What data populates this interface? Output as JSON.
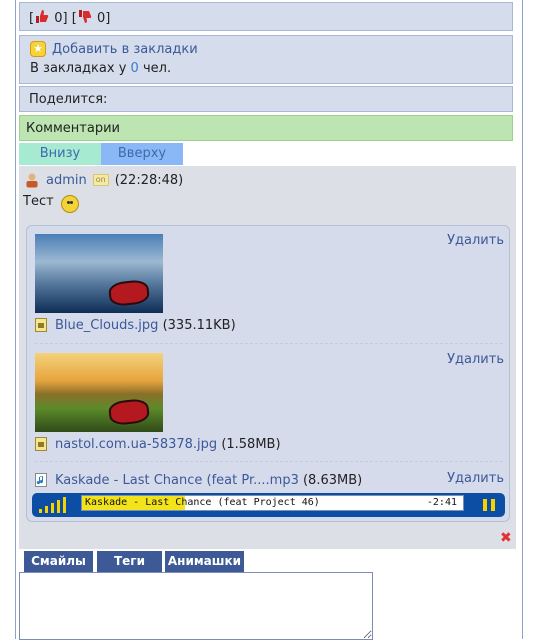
{
  "votes": {
    "open_bracket1": "[",
    "likes": "0",
    "close_bracket1": "]",
    "open_bracket2": "[",
    "dislikes": "0",
    "close_bracket2": "]",
    "like_icon": "thumbs-up-icon",
    "dislike_icon": "thumbs-down-icon"
  },
  "bookmarks": {
    "add_label": "Добавить в закладки",
    "prefix": "В закладках у",
    "count": "0",
    "suffix": "чел."
  },
  "share": {
    "label": "Поделится:"
  },
  "comments": {
    "header": "Комментарии",
    "tabs": [
      "Внизу",
      "Вверху"
    ]
  },
  "comment": {
    "author": "admin",
    "status_badge": "on",
    "time": "(22:28:48)",
    "text": "Тест"
  },
  "attachments": [
    {
      "name": "Blue_Clouds.jpg",
      "size": "(335.11KB)",
      "delete": "Удалить"
    },
    {
      "name": "nastol.com.ua-58378.jpg",
      "size": "(1.58MB)",
      "delete": "Удалить"
    },
    {
      "name": "Kaskade - Last Chance (feat Pr....mp3",
      "size": "(8.63MB)",
      "delete": "Удалить"
    }
  ],
  "player": {
    "title": "Kaskade - Last Chance (feat Project 46)",
    "time": "-2:41",
    "progress": 0.27
  },
  "editor": {
    "tabs": [
      "Смайлы",
      "Теги",
      "Анимашки"
    ]
  },
  "colors": {
    "accent": "#3b5998",
    "comments_header": "#bde5b1",
    "player_bg": "#0c4ea3",
    "player_fill": "#f2e31b"
  }
}
